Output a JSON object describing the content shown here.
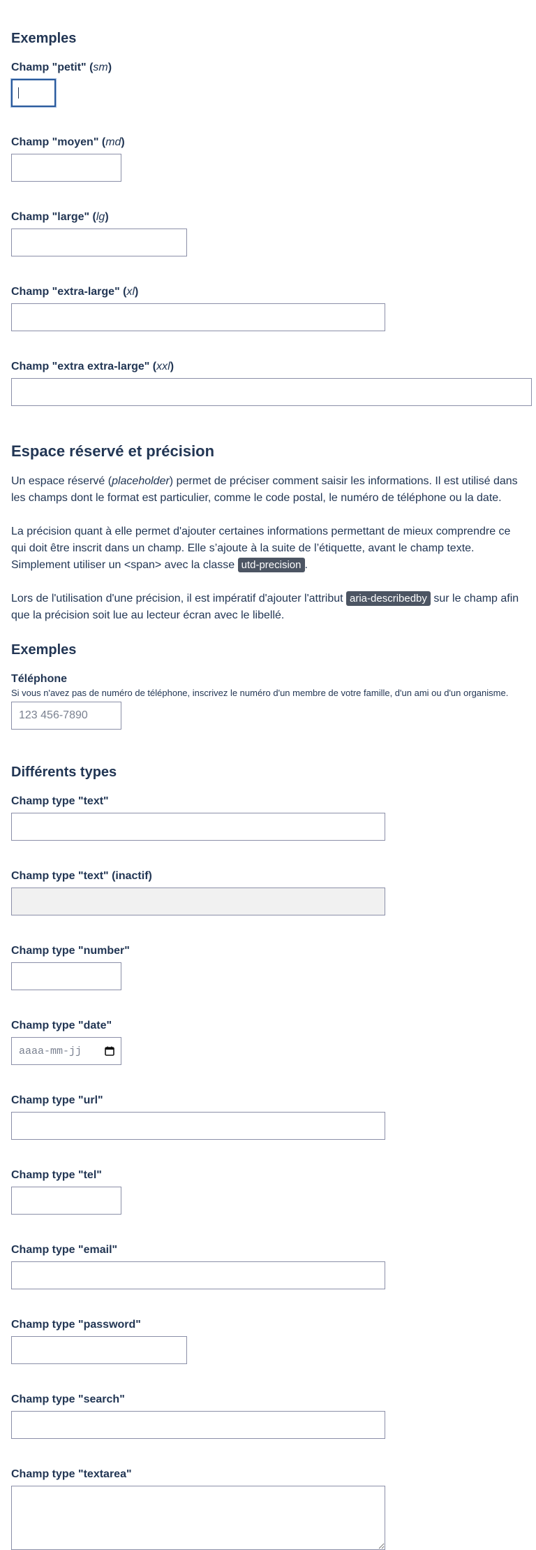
{
  "examples1": {
    "heading": "Exemples",
    "fields": [
      {
        "label": "Champ \"petit\" (",
        "code": "sm",
        "suffix": ")"
      },
      {
        "label": "Champ \"moyen\" (",
        "code": "md",
        "suffix": ")"
      },
      {
        "label": "Champ \"large\" (",
        "code": "lg",
        "suffix": ")"
      },
      {
        "label": "Champ \"extra-large\" (",
        "code": "xl",
        "suffix": ")"
      },
      {
        "label": "Champ \"extra extra-large\" (",
        "code": "xxl",
        "suffix": ")"
      }
    ]
  },
  "placeholder_section": {
    "heading": "Espace réservé et précision",
    "p1_a": "Un espace réservé (",
    "p1_em": "placeholder",
    "p1_b": ") permet de préciser comment saisir les informations. Il est utilisé dans les champs dont le format est particulier, comme le code postal, le numéro de téléphone ou la date.",
    "p2_a": "La précision quant à elle permet d'ajouter certaines informations permettant de mieux comprendre ce qui doit être inscrit dans un champ. Elle s’ajoute à la suite de l’étiquette, avant le champ texte. Simplement utiliser un <span> avec la classe ",
    "p2_code": "utd-precision",
    "p2_b": ".",
    "p3_a": "Lors de l'utilisation d'une précision, il est impératif d'ajouter l'attribut ",
    "p3_code": "aria-describedby",
    "p3_b": " sur le champ afin que la précision soit lue au lecteur écran avec le libellé."
  },
  "examples2": {
    "heading": "Exemples",
    "phone_label": "Téléphone",
    "phone_precision": "Si vous n'avez pas de numéro de téléphone, inscrivez le numéro d'un membre de votre famille, d'un ami ou d'un organisme.",
    "phone_placeholder": "123 456-7890"
  },
  "types": {
    "heading": "Différents types",
    "text": "Champ type \"text\"",
    "text_disabled": "Champ type \"text\" (inactif)",
    "number": "Champ type \"number\"",
    "date": "Champ type \"date\"",
    "date_placeholder": "aaaa-mm-jj",
    "url": "Champ type \"url\"",
    "tel": "Champ type \"tel\"",
    "email": "Champ type \"email\"",
    "password": "Champ type \"password\"",
    "search": "Champ type \"search\"",
    "textarea": "Champ type \"textarea\""
  }
}
